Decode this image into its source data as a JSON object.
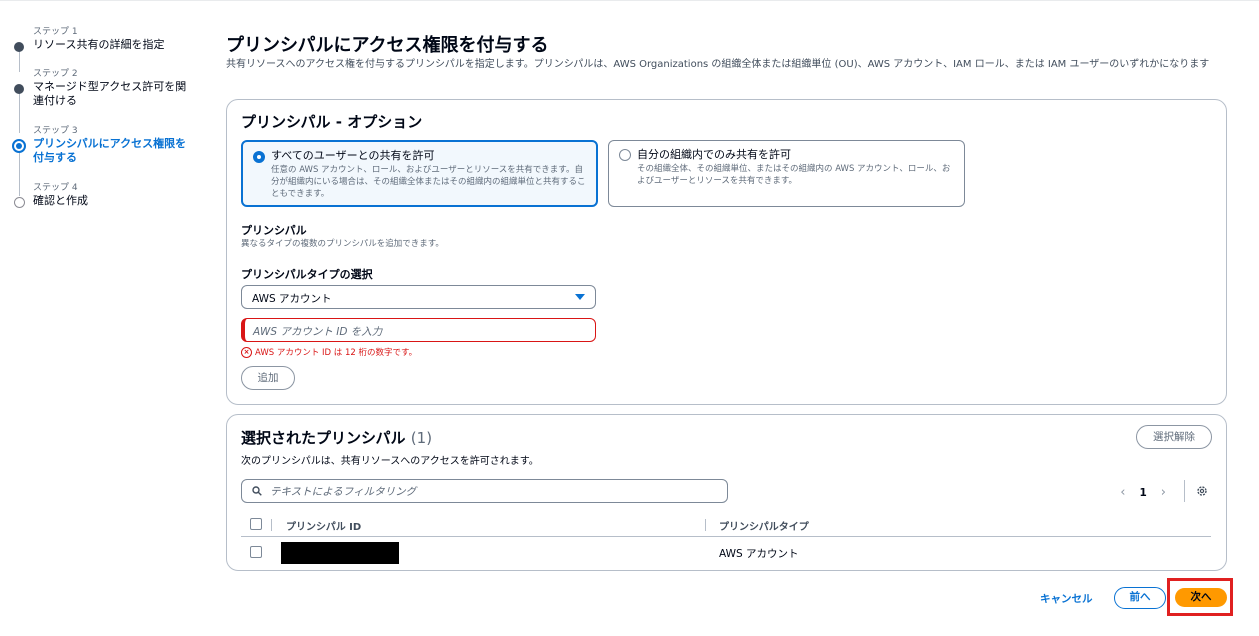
{
  "steps": [
    {
      "num": "ステップ 1",
      "label": "リソース共有の詳細を指定",
      "state": "done"
    },
    {
      "num": "ステップ 2",
      "label": "マネージド型アクセス許可を関連付ける",
      "state": "done"
    },
    {
      "num": "ステップ 3",
      "label": "プリンシパルにアクセス権限を付与する",
      "state": "active"
    },
    {
      "num": "ステップ 4",
      "label": "確認と作成",
      "state": "pending"
    }
  ],
  "header": {
    "title": "プリンシパルにアクセス権限を付与する",
    "description": "共有リソースへのアクセス権を付与するプリンシパルを指定します。プリンシパルは、AWS Organizations の組織全体または組織単位 (OU)、AWS アカウント、IAM ロール、または IAM ユーザーのいずれかになります"
  },
  "options_panel": {
    "title": "プリンシパル - オプション",
    "tiles": [
      {
        "label": "すべてのユーザーとの共有を許可",
        "description": "任意の AWS アカウント、ロール、およびユーザーとリソースを共有できます。自分が組織内にいる場合は、その組織全体またはその組織内の組織単位と共有することもできます。",
        "selected": true
      },
      {
        "label": "自分の組織内でのみ共有を許可",
        "description": "その組織全体、その組織単位、またはその組織内の AWS アカウント、ロール、およびユーザーとリソースを共有できます。",
        "selected": false
      }
    ],
    "principal_label": "プリンシパル",
    "principal_desc": "異なるタイプの複数のプリンシパルを追加できます。",
    "type_label": "プリンシパルタイプの選択",
    "type_value": "AWS アカウント",
    "id_placeholder": "AWS アカウント ID を入力",
    "error": "AWS アカウント ID は 12 桁の数字です。",
    "add_button": "追加"
  },
  "selected_panel": {
    "title": "選択されたプリンシパル",
    "count": "(1)",
    "clear_button": "選択解除",
    "description": "次のプリンシパルは、共有リソースへのアクセスを許可されます。",
    "filter_placeholder": "テキストによるフィルタリング",
    "page": "1",
    "columns": [
      "プリンシパル ID",
      "プリンシパルタイプ"
    ],
    "rows": [
      {
        "type": "AWS アカウント"
      }
    ]
  },
  "footer": {
    "cancel": "キャンセル",
    "prev": "前へ",
    "next": "次へ"
  },
  "colors": {
    "accent": "#0972d3",
    "primary_button": "#ff9900",
    "error": "#d91515",
    "highlight": "#e02020"
  }
}
